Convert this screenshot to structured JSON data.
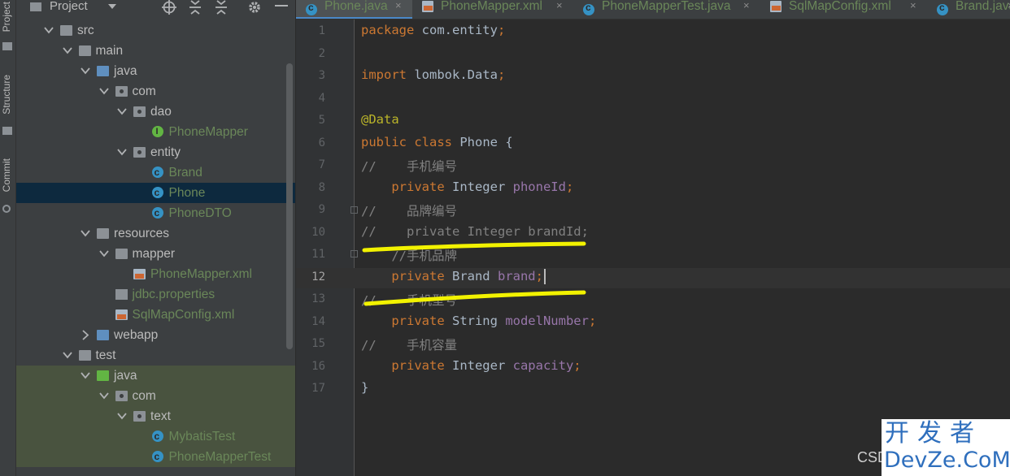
{
  "toolstrip": {
    "items": [
      {
        "label": "Project"
      },
      {
        "label": "Structure"
      },
      {
        "label": "Commit"
      }
    ]
  },
  "project_panel": {
    "title": "Project",
    "tree": [
      {
        "label": "src",
        "indent": 0,
        "arrow": "down",
        "icon": "folder-icon",
        "color": "#bbbbbb"
      },
      {
        "label": "main",
        "indent": 1,
        "arrow": "down",
        "icon": "folder-icon",
        "color": "#bbbbbb"
      },
      {
        "label": "java",
        "indent": 2,
        "arrow": "down",
        "icon": "source-folder-icon",
        "color": "#bbbbbb"
      },
      {
        "label": "com",
        "indent": 3,
        "arrow": "down",
        "icon": "package-icon",
        "color": "#bbbbbb"
      },
      {
        "label": "dao",
        "indent": 4,
        "arrow": "down",
        "icon": "package-icon",
        "color": "#bbbbbb"
      },
      {
        "label": "PhoneMapper",
        "indent": 5,
        "arrow": "",
        "icon": "interface-icon",
        "color": "#6a8759"
      },
      {
        "label": "entity",
        "indent": 4,
        "arrow": "down",
        "icon": "package-icon",
        "color": "#bbbbbb"
      },
      {
        "label": "Brand",
        "indent": 5,
        "arrow": "",
        "icon": "class-icon",
        "color": "#6a8759"
      },
      {
        "label": "Phone",
        "indent": 5,
        "arrow": "",
        "icon": "class-icon",
        "color": "#6a8759",
        "selected": true
      },
      {
        "label": "PhoneDTO",
        "indent": 5,
        "arrow": "",
        "icon": "class-icon",
        "color": "#6a8759"
      },
      {
        "label": "resources",
        "indent": 2,
        "arrow": "down",
        "icon": "resources-folder-icon",
        "color": "#bbbbbb"
      },
      {
        "label": "mapper",
        "indent": 3,
        "arrow": "down",
        "icon": "folder-icon",
        "color": "#bbbbbb"
      },
      {
        "label": "PhoneMapper.xml",
        "indent": 4,
        "arrow": "",
        "icon": "xml-file-icon",
        "color": "#6a8759"
      },
      {
        "label": "jdbc.properties",
        "indent": 3,
        "arrow": "",
        "icon": "properties-file-icon",
        "color": "#6a8759"
      },
      {
        "label": "SqlMapConfig.xml",
        "indent": 3,
        "arrow": "",
        "icon": "xml-file-icon",
        "color": "#6a8759"
      },
      {
        "label": "webapp",
        "indent": 2,
        "arrow": "right",
        "icon": "web-folder-icon",
        "color": "#bbbbbb"
      },
      {
        "label": "test",
        "indent": 1,
        "arrow": "down",
        "icon": "folder-icon",
        "color": "#bbbbbb"
      },
      {
        "label": "java",
        "indent": 2,
        "arrow": "down",
        "icon": "test-folder-icon",
        "color": "#bbbbbb",
        "test": true
      },
      {
        "label": "com",
        "indent": 3,
        "arrow": "down",
        "icon": "package-icon",
        "color": "#bbbbbb",
        "test": true
      },
      {
        "label": "text",
        "indent": 4,
        "arrow": "down",
        "icon": "package-icon",
        "color": "#bbbbbb",
        "test": true
      },
      {
        "label": "MybatisTest",
        "indent": 5,
        "arrow": "",
        "icon": "test-class-icon",
        "color": "#6a8759",
        "test": true
      },
      {
        "label": "PhoneMapperTest",
        "indent": 5,
        "arrow": "",
        "icon": "test-class-icon",
        "color": "#6a8759",
        "test": true
      }
    ]
  },
  "tabs": [
    {
      "label": "Phone.java",
      "active": true,
      "icon": "class-icon",
      "color": "#6a8759"
    },
    {
      "label": "PhoneMapper.xml",
      "active": false,
      "icon": "xml-file-icon",
      "color": "#6a8759"
    },
    {
      "label": "PhoneMapperTest.java",
      "active": false,
      "icon": "class-icon",
      "color": "#6a8759"
    },
    {
      "label": "SqlMapConfig.xml",
      "active": false,
      "icon": "xml-file-icon",
      "color": "#6a8759"
    },
    {
      "label": "Brand.java",
      "active": false,
      "icon": "class-icon",
      "color": "#6a8759"
    }
  ],
  "editor": {
    "current_line": 12,
    "lines": [
      {
        "n": "1",
        "segments": [
          {
            "t": "package ",
            "c": "kw"
          },
          {
            "t": "com.entity",
            "c": ""
          },
          {
            "t": ";",
            "c": "kw"
          }
        ]
      },
      {
        "n": "2",
        "segments": []
      },
      {
        "n": "3",
        "segments": [
          {
            "t": "import ",
            "c": "kw"
          },
          {
            "t": "lombok.Data",
            "c": ""
          },
          {
            "t": ";",
            "c": "kw"
          }
        ]
      },
      {
        "n": "4",
        "segments": []
      },
      {
        "n": "5",
        "segments": [
          {
            "t": "@Data",
            "c": "ann"
          }
        ]
      },
      {
        "n": "6",
        "segments": [
          {
            "t": "public class ",
            "c": "kw"
          },
          {
            "t": "Phone {",
            "c": ""
          }
        ]
      },
      {
        "n": "7",
        "segments": [
          {
            "t": "//    手机编号",
            "c": "cmt"
          }
        ]
      },
      {
        "n": "8",
        "segments": [
          {
            "t": "    private ",
            "c": "kw"
          },
          {
            "t": "Integer ",
            "c": ""
          },
          {
            "t": "phoneId",
            "c": "fld"
          },
          {
            "t": ";",
            "c": "kw"
          }
        ]
      },
      {
        "n": "9",
        "segments": [
          {
            "t": "//    品牌编号",
            "c": "cmt"
          }
        ]
      },
      {
        "n": "10",
        "segments": [
          {
            "t": "//    private Integer brandId;",
            "c": "cmt"
          }
        ]
      },
      {
        "n": "11",
        "segments": [
          {
            "t": "    //手机品牌",
            "c": "cmt"
          }
        ]
      },
      {
        "n": "12",
        "segments": [
          {
            "t": "    private ",
            "c": "kw"
          },
          {
            "t": "Brand ",
            "c": ""
          },
          {
            "t": "brand",
            "c": "fld"
          },
          {
            "t": ";",
            "c": "kw"
          }
        ]
      },
      {
        "n": "13",
        "segments": [
          {
            "t": "//    手机型号",
            "c": "cmt"
          }
        ]
      },
      {
        "n": "14",
        "segments": [
          {
            "t": "    private ",
            "c": "kw"
          },
          {
            "t": "String ",
            "c": ""
          },
          {
            "t": "modelNumber",
            "c": "fld"
          },
          {
            "t": ";",
            "c": "kw"
          }
        ]
      },
      {
        "n": "15",
        "segments": [
          {
            "t": "//    手机容量",
            "c": "cmt"
          }
        ]
      },
      {
        "n": "16",
        "segments": [
          {
            "t": "    private ",
            "c": "kw"
          },
          {
            "t": "Integer ",
            "c": ""
          },
          {
            "t": "capacity",
            "c": "fld"
          },
          {
            "t": ";",
            "c": "kw"
          }
        ]
      },
      {
        "n": "17",
        "segments": [
          {
            "t": "}",
            "c": ""
          }
        ]
      }
    ]
  },
  "watermark": {
    "csd": "CSD",
    "line1": "开发者",
    "line2": "DevZe.CoM"
  },
  "colors": {
    "highlight_scribble": "#f2f200",
    "selection": "#0d293e",
    "test_background": "#49533f",
    "watermark_blue": "#2f6fbd"
  }
}
